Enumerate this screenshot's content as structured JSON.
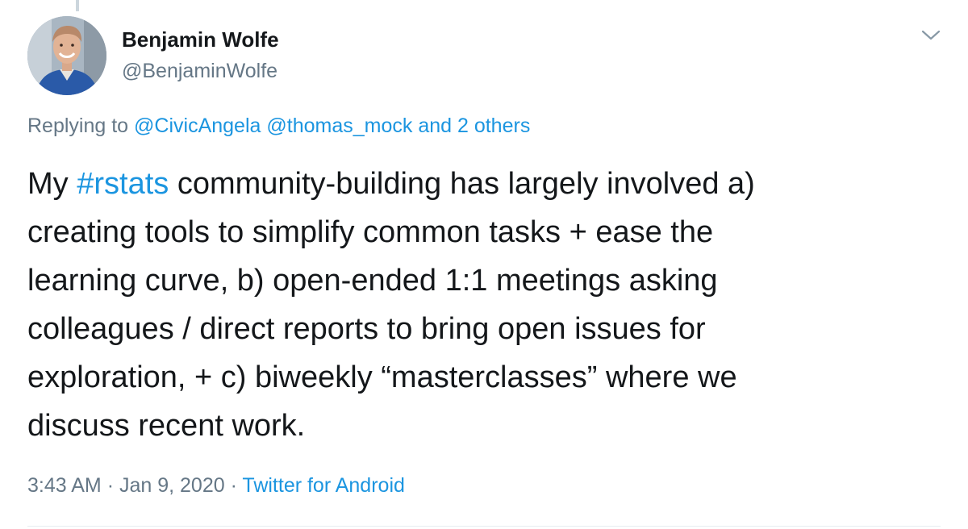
{
  "author": {
    "name": "Benjamin Wolfe",
    "handle": "@BenjaminWolfe"
  },
  "reply": {
    "prefix": "Replying to",
    "mention_1": "@CivicAngela",
    "mention_2": "@thomas_mock",
    "others": "and 2 others"
  },
  "tweet": {
    "lines": [
      "community-building has largely involved a)",
      "creating tools to simplify common tasks + ease the",
      "learning curve, b) open-ended 1:1 meetings asking",
      "colleagues / direct reports to bring open issues for",
      "exploration, + c) biweekly “masterclasses” where we",
      "discuss recent work."
    ],
    "first_word": "My",
    "hashtag": "#rstats"
  },
  "meta": {
    "time": "3:43 AM",
    "separator": "·",
    "date": "Jan 9, 2020",
    "source": "Twitter for Android"
  },
  "icons": {
    "menu": "chevron-down-icon",
    "avatar": "profile-photo"
  },
  "colors": {
    "link": "#1b95e0",
    "secondary_text": "#657786",
    "primary_text": "#14171a"
  }
}
